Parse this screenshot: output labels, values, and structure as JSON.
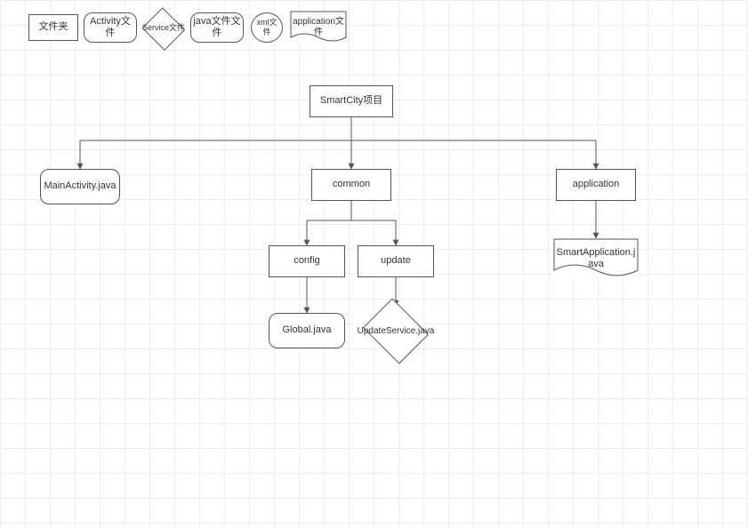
{
  "legend": {
    "folder": "文件夹",
    "activity": "Activity文件",
    "service": "Service文件",
    "java": "java文件文件",
    "xml": "xml文件",
    "application": "application文件"
  },
  "nodes": {
    "root": "SmartCity项目",
    "mainActivity": "MainActivity.java",
    "common": "common",
    "application": "application",
    "config": "config",
    "update": "update",
    "global": "Global.java",
    "updateService": "UpdateService.java",
    "smartApplication": "SmartApplication.java"
  }
}
